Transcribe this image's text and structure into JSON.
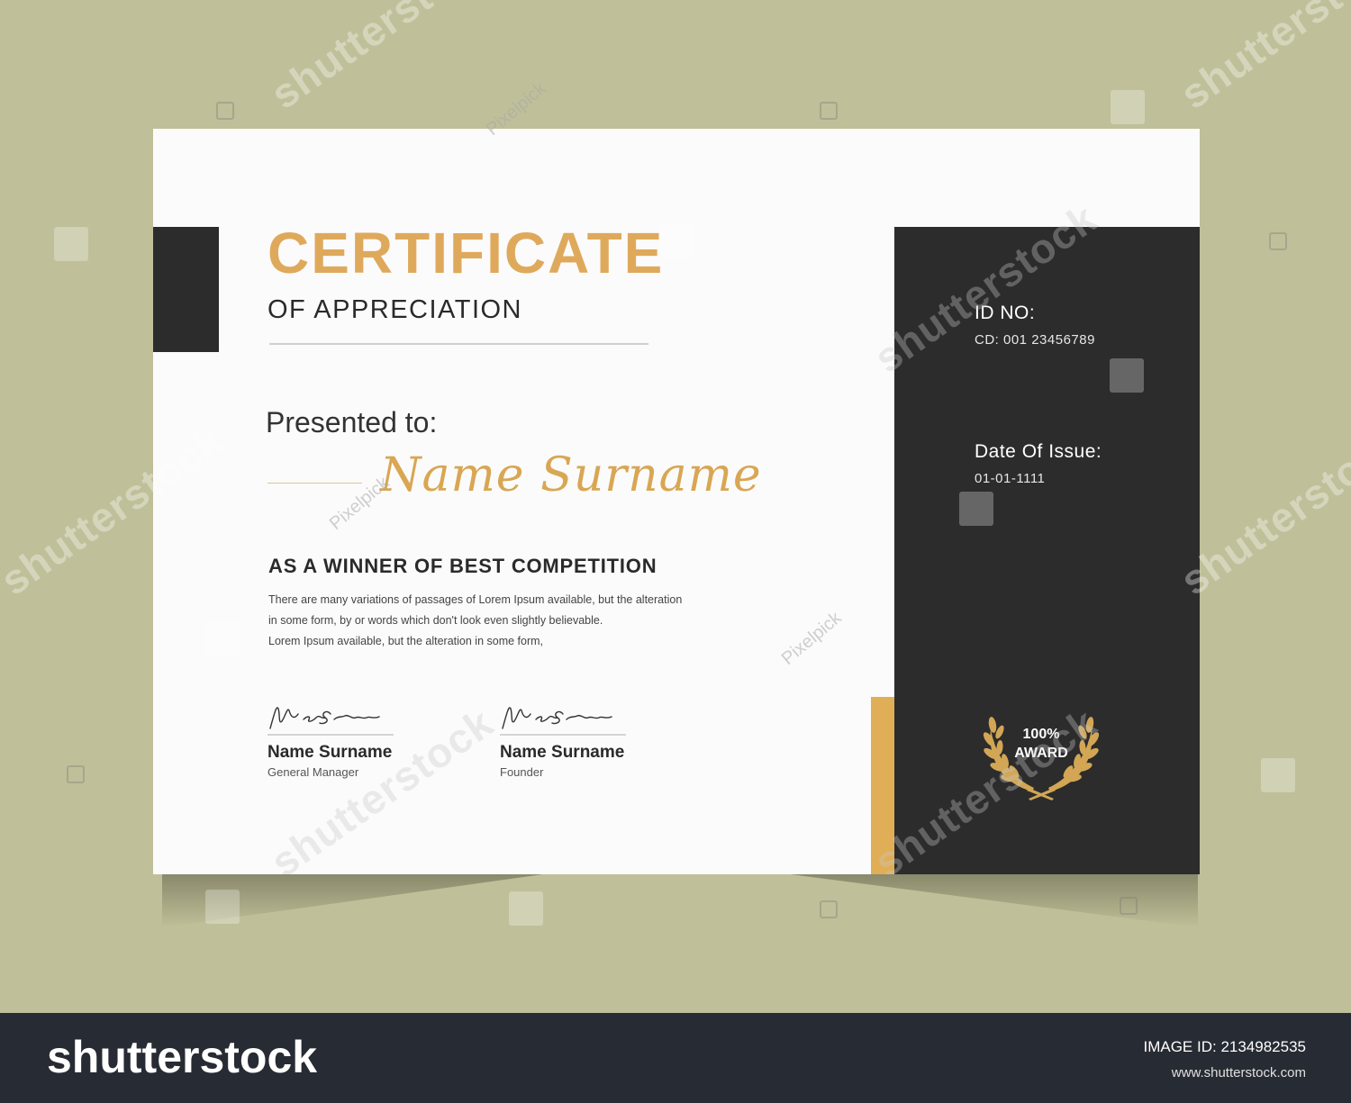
{
  "certificate": {
    "title": "CERTIFICATE",
    "subtitle": "OF APPRECIATION",
    "presented_label": "Presented to:",
    "recipient_name": "Name Surname",
    "achievement": "AS A WINNER OF BEST COMPETITION",
    "body_lines": [
      "There are many variations of passages of Lorem Ipsum available, but the  alteration",
      "in some form, by or words which don't look even slightly believable.",
      "Lorem Ipsum available, but the  alteration in some form,"
    ],
    "signatories": [
      {
        "name": "Name Surname",
        "role": "General Manager"
      },
      {
        "name": "Name Surname",
        "role": "Founder"
      }
    ],
    "side_panel": {
      "id_label": "ID NO:",
      "id_value": "CD: 001 23456789",
      "date_label": "Date Of Issue:",
      "date_value": "01-01-1111"
    },
    "award_badge": {
      "line1": "100%",
      "line2": "AWARD"
    }
  },
  "watermarks": {
    "brand_text": "shutterstock",
    "pixelpick_text": "Pixelpick"
  },
  "footer": {
    "brand": "shutterstock",
    "image_id": "IMAGE ID: 2134982535",
    "site": "www.shutterstock.com"
  },
  "colors": {
    "background": "#bfbf99",
    "paper": "#fbfbfb",
    "gold": "#dfa95c",
    "dark": "#2c2c2c",
    "footer": "#272b33"
  }
}
